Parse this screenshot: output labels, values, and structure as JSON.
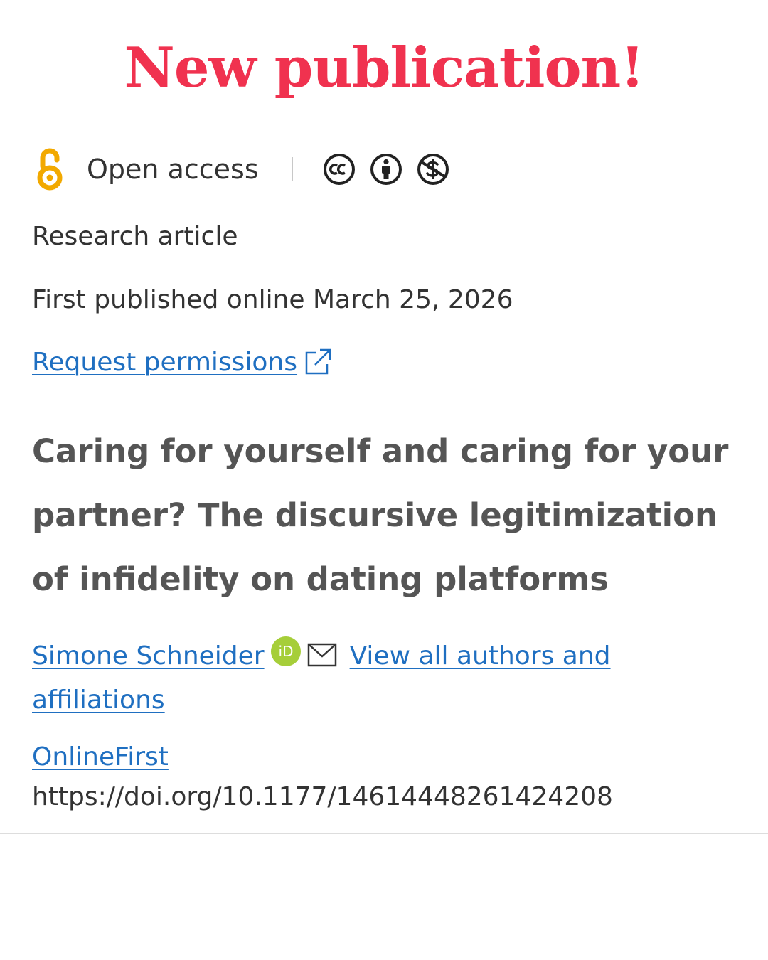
{
  "headline": "New publication!",
  "access": {
    "label": "Open access",
    "icon": "open-access-icon",
    "license_icons": [
      "creative-commons-icon",
      "attribution-icon",
      "non-commercial-icon"
    ],
    "accent_color": "#f2a900"
  },
  "article_type": "Research article",
  "published": "First published online March 25, 2026",
  "permissions_link": "Request permissions",
  "title": "Caring for yourself and caring for your partner? The discursive legitimization of infidelity on dating platforms",
  "authors": {
    "name": "Simone Schneider",
    "orcid_label": "iD",
    "view_all": "View all authors and affiliations"
  },
  "section": "OnlineFirst",
  "doi": "https://doi.org/10.1177/14614448261424208",
  "colors": {
    "headline": "#f0324f",
    "link": "#1f6fc1",
    "orcid": "#a6ce39",
    "text": "#333333"
  }
}
